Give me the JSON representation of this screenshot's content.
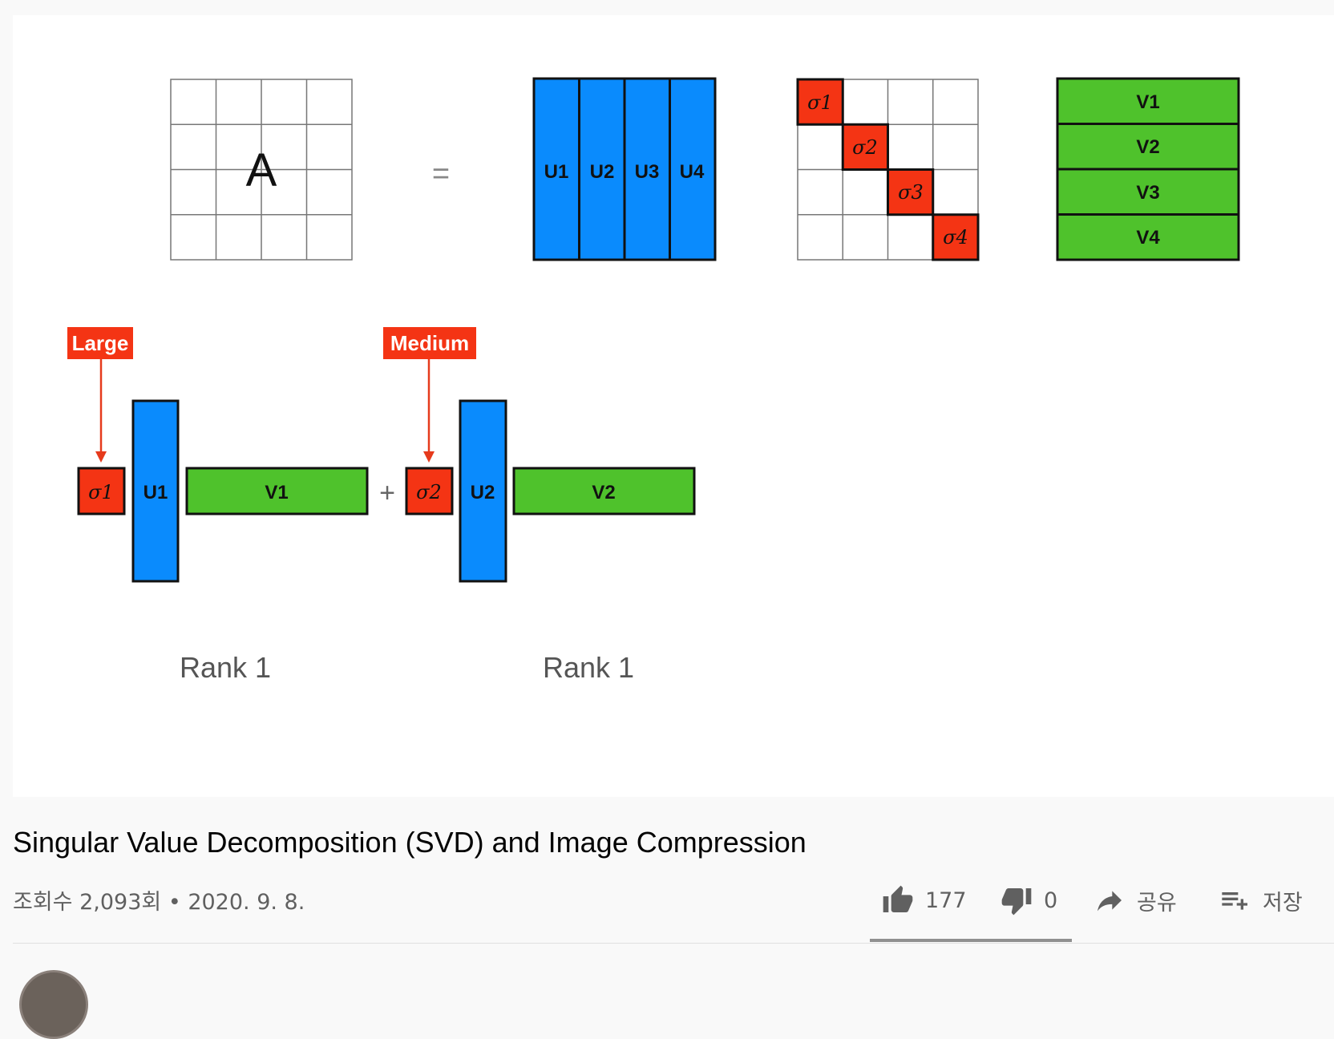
{
  "video": {
    "matrix_a_label": "A",
    "equals_sign": "=",
    "u_columns": [
      "U1",
      "U2",
      "U3",
      "U4"
    ],
    "sigma_labels": [
      "σ1",
      "σ2",
      "σ3",
      "σ4"
    ],
    "v_rows": [
      "V1",
      "V2",
      "V3",
      "V4"
    ],
    "plus_sign": "+",
    "callouts": [
      "Large",
      "Medium"
    ],
    "terms": [
      {
        "sigma": "σ1",
        "u": "U1",
        "v": "V1",
        "rank_label": "Rank 1"
      },
      {
        "sigma": "σ2",
        "u": "U2",
        "v": "V2",
        "rank_label": "Rank 1"
      }
    ],
    "colors": {
      "blue": "#0a8bfd",
      "green": "#4fc22c",
      "red": "#f43414"
    }
  },
  "info": {
    "title": "Singular Value Decomposition (SVD) and Image Compression",
    "meta": "조회수 2,093회 • 2020. 9. 8."
  },
  "actions": {
    "like_count": "177",
    "dislike_count": "0",
    "share_label": "공유",
    "save_label": "저장",
    "icons": [
      "thumb-up-icon",
      "thumb-down-icon",
      "share-icon",
      "playlist-add-icon"
    ]
  }
}
